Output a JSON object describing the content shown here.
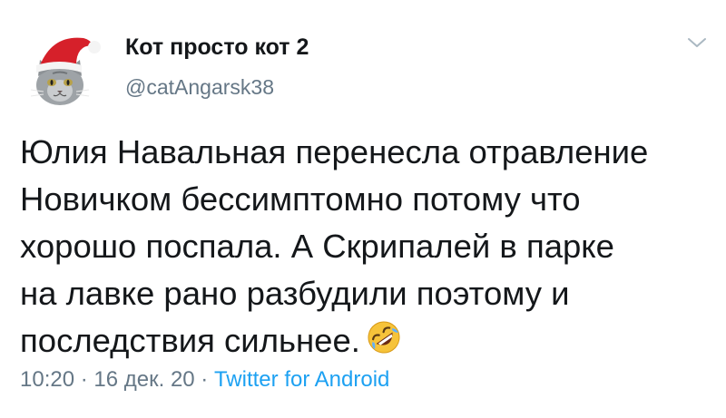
{
  "author": {
    "display_name": "Кот просто кот 2",
    "handle": "@catAngarsk38",
    "avatar_icon": "cat-santa-hat-avatar"
  },
  "menu_icon": "chevron-down-icon",
  "tweet": {
    "lines": [
      "Юлия Навальная перенесла отравление",
      "Новичком бессимптомно потому что",
      "хорошо поспала. А Скрипалей в парке",
      "на лавке рано разбудили поэтому и",
      "последствия сильнее."
    ],
    "emoji": "rolling-on-floor-laughing-emoji"
  },
  "meta": {
    "time": "10:20",
    "sep1": " · ",
    "date": "16 дек. 20",
    "sep2": " · ",
    "source": "Twitter for Android"
  },
  "colors": {
    "text": "#14171a",
    "secondary": "#657786",
    "link": "#1da1f2"
  }
}
